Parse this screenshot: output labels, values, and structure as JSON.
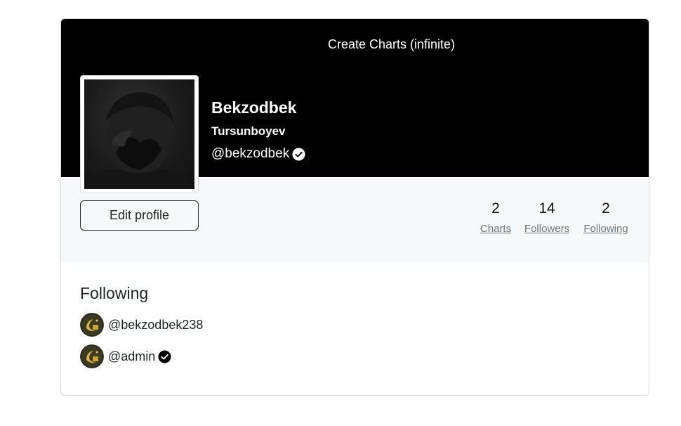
{
  "cover": {
    "link_label": "Create Charts (infinite)",
    "background_color": "#000000"
  },
  "profile": {
    "first_name": "Bekzodbek",
    "last_name": "Tursunboyev",
    "handle": "@bekzodbek",
    "verified": true,
    "avatar_icon": "profile-photo"
  },
  "actions": {
    "edit_label": "Edit profile"
  },
  "stats": [
    {
      "value": "2",
      "label": "Charts"
    },
    {
      "value": "14",
      "label": "Followers"
    },
    {
      "value": "2",
      "label": "Following"
    }
  ],
  "following_section": {
    "title": "Following",
    "users": [
      {
        "handle": "@bekzodbek238",
        "verified": false,
        "avatar_icon": "gold-crescent-avatar"
      },
      {
        "handle": "@admin",
        "verified": true,
        "avatar_icon": "gold-crescent-avatar"
      }
    ]
  },
  "colors": {
    "accent_text": "#212529",
    "muted_text": "#6c757d",
    "band_background": "#f7f8f9"
  }
}
